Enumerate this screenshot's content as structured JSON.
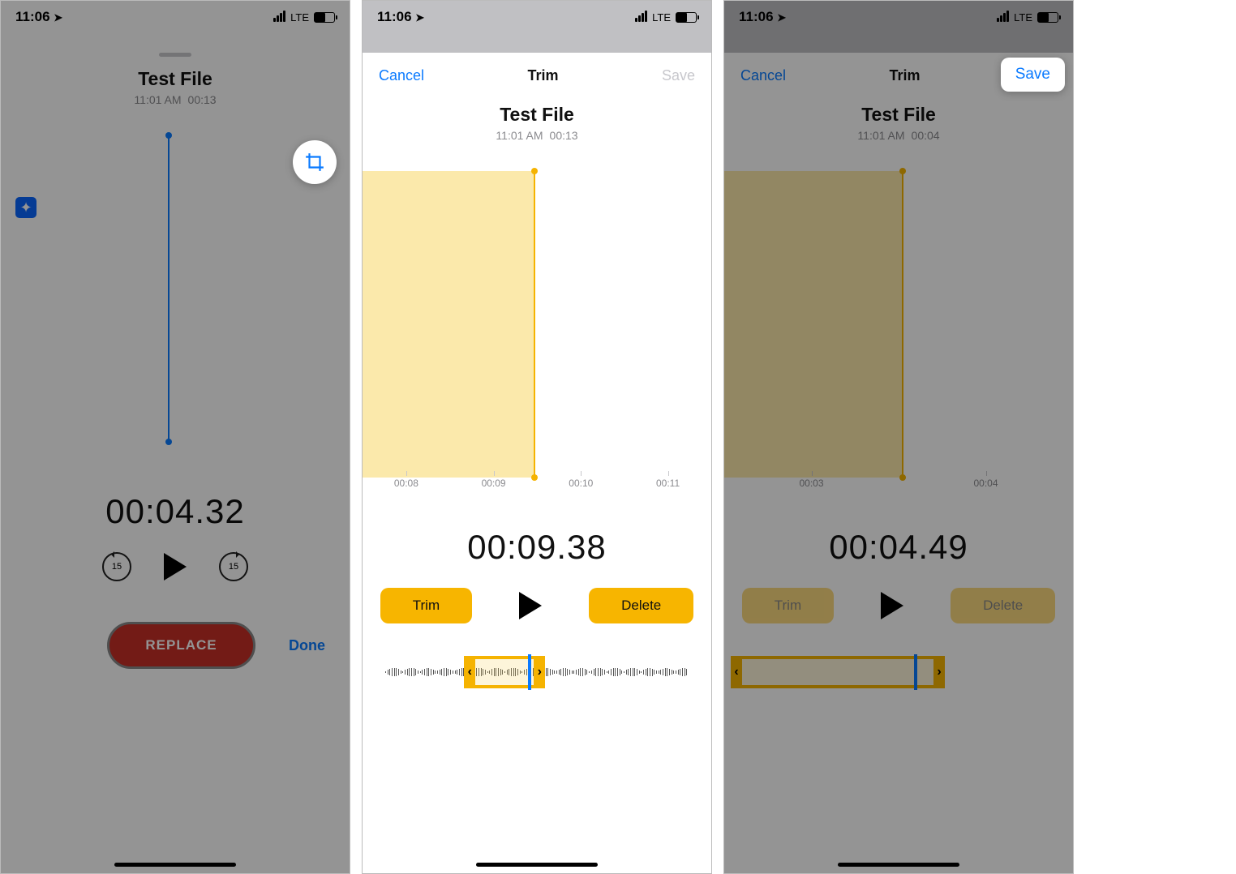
{
  "screen1": {
    "status_time": "11:06",
    "lte": "LTE",
    "file_name": "Test File",
    "file_time": "11:01 AM",
    "file_dur": "00:13",
    "big_time": "00:04.32",
    "skip_label": "15",
    "replace": "REPLACE",
    "done": "Done"
  },
  "screen2": {
    "status_time": "11:06",
    "lte": "LTE",
    "cancel": "Cancel",
    "title": "Trim",
    "save": "Save",
    "file_name": "Test File",
    "file_time": "11:01 AM",
    "file_dur": "00:13",
    "ticks": [
      "00:08",
      "00:09",
      "00:10",
      "00:11"
    ],
    "big_time": "00:09.38",
    "trim": "Trim",
    "delete": "Delete"
  },
  "screen3": {
    "status_time": "11:06",
    "lte": "LTE",
    "cancel": "Cancel",
    "title": "Trim",
    "save": "Save",
    "file_name": "Test File",
    "file_time": "11:01 AM",
    "file_dur": "00:04",
    "ticks": [
      "00:03",
      "00:04"
    ],
    "big_time": "00:04.49",
    "trim": "Trim",
    "delete": "Delete",
    "save_bubble": "Save"
  }
}
